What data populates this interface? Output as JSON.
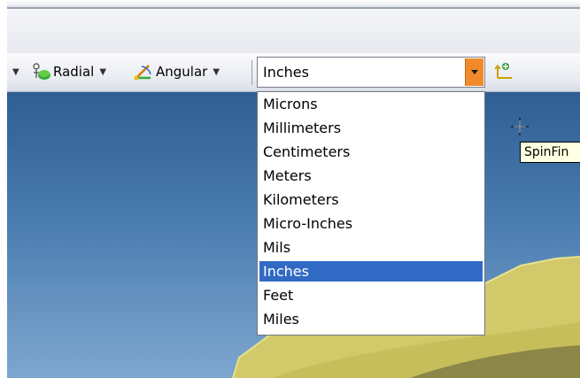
{
  "toolbar": {
    "radial_label": "Radial",
    "angular_label": "Angular"
  },
  "units_combo": {
    "selected": "Inches",
    "options": [
      "Microns",
      "Millimeters",
      "Centimeters",
      "Meters",
      "Kilometers",
      "Micro-Inches",
      "Mils",
      "Inches",
      "Feet",
      "Miles"
    ]
  },
  "tooltip": {
    "text": "SpinFin"
  },
  "colors": {
    "selection": "#316ac5",
    "combo_button": "#f28a2c",
    "viewport_top": "#2f5e93",
    "viewport_bottom": "#7ea7cf",
    "part": "#d1c96a"
  },
  "icons": [
    "radial-measure-icon",
    "angular-measure-icon",
    "add-point-icon",
    "crosshair-cursor-icon"
  ]
}
